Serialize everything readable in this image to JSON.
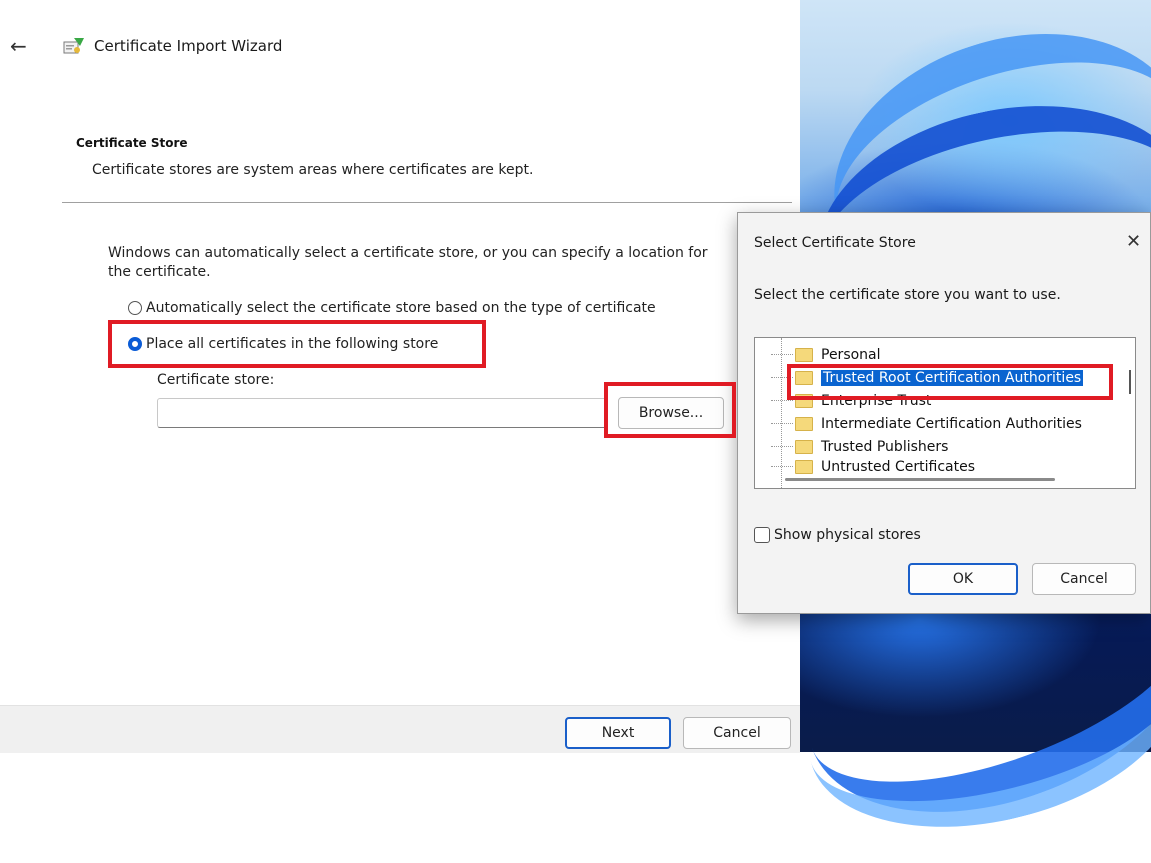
{
  "wizard": {
    "title": "Certificate Import Wizard",
    "section_heading": "Certificate Store",
    "section_description": "Certificate stores are system areas where certificates are kept.",
    "intro": "Windows can automatically select a certificate store, or you can specify a location for the certificate.",
    "option_auto": "Automatically select the certificate store based on the type of certificate",
    "option_place": "Place all certificates in the following store",
    "store_label": "Certificate store:",
    "store_value": "",
    "browse_label": "Browse...",
    "next_label": "Next",
    "cancel_label": "Cancel"
  },
  "dialog": {
    "title": "Select Certificate Store",
    "close_glyph": "✕",
    "prompt": "Select the certificate store you want to use.",
    "stores": [
      "Personal",
      "Trusted Root Certification Authorities",
      "Enterprise Trust",
      "Intermediate Certification Authorities",
      "Trusted Publishers",
      "Untrusted Certificates"
    ],
    "selected_store": "Trusted Root Certification Authorities",
    "show_physical_label": "Show physical stores",
    "ok_label": "OK",
    "cancel_label": "Cancel"
  },
  "icons": {
    "back": "back-arrow-icon",
    "wizard": "certificate-wizard-icon",
    "close": "close-icon",
    "folder": "folder-icon"
  },
  "colors": {
    "highlight": "#e01b24",
    "accent": "#0a5bd6",
    "selection": "#0a64d0"
  }
}
